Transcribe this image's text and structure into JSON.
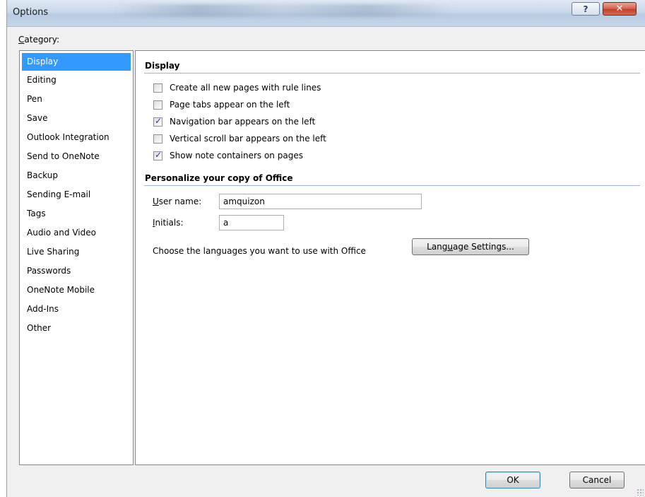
{
  "window": {
    "title": "Options",
    "help_glyph": "?",
    "close_glyph": "✕"
  },
  "sidebar": {
    "label_prefix": "C",
    "label_rest": "ategory:",
    "items": [
      {
        "label": "Display",
        "selected": true
      },
      {
        "label": "Editing"
      },
      {
        "label": "Pen"
      },
      {
        "label": "Save"
      },
      {
        "label": "Outlook Integration"
      },
      {
        "label": "Send to OneNote"
      },
      {
        "label": "Backup"
      },
      {
        "label": "Sending E-mail"
      },
      {
        "label": "Tags"
      },
      {
        "label": "Audio and Video"
      },
      {
        "label": "Live Sharing"
      },
      {
        "label": "Passwords"
      },
      {
        "label": "OneNote Mobile"
      },
      {
        "label": "Add-Ins"
      },
      {
        "label": "Other"
      }
    ]
  },
  "display": {
    "heading": "Display",
    "options": [
      {
        "label": "Create all new pages with rule lines",
        "checked": false
      },
      {
        "label": "Page tabs appear on the left",
        "checked": false
      },
      {
        "label": "Navigation bar appears on the left",
        "checked": true
      },
      {
        "label": "Vertical scroll bar appears on the left",
        "checked": false
      },
      {
        "label": "Show note containers on pages",
        "checked": true
      }
    ]
  },
  "personalize": {
    "heading": "Personalize your copy of Office",
    "user_name_label_u": "U",
    "user_name_label_rest": "ser name:",
    "user_name_value": "amquizon",
    "initials_label_u": "I",
    "initials_label_rest": "nitials:",
    "initials_value": "a",
    "languages_text": "Choose the languages you want to use with Office",
    "language_button_pre": "Lang",
    "language_button_u": "u",
    "language_button_post": "age Settings..."
  },
  "footer": {
    "ok_label": "OK",
    "cancel_label": "Cancel"
  },
  "colors": {
    "selection": "#3399ff",
    "section_rule": "#9cb7d8",
    "close_button": "#c1412b"
  }
}
